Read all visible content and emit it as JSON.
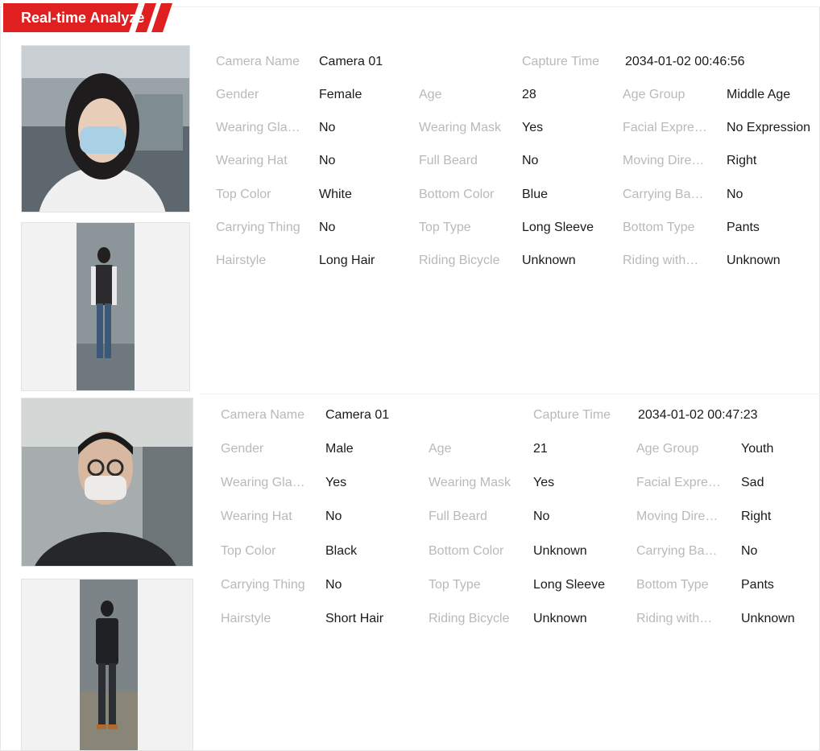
{
  "header": {
    "title": "Real-time Analyze",
    "accent": "#e02020"
  },
  "records": [
    {
      "face_image": "female-face-with-mask",
      "body_image": "female-full-body",
      "camera_name_label": "Camera Name",
      "camera_name": "Camera 01",
      "capture_time_label": "Capture Time",
      "capture_time": "2034-01-02 00:46:56",
      "attributes": [
        [
          "Gender",
          "Female",
          "Age",
          "28",
          "Age Group",
          "Middle Age"
        ],
        [
          "Wearing Gla…",
          "No",
          "Wearing Mask",
          "Yes",
          "Facial Expre…",
          "No Expression"
        ],
        [
          "Wearing Hat",
          "No",
          "Full Beard",
          "No",
          "Moving Dire…",
          "Right"
        ],
        [
          "Top Color",
          "White",
          "Bottom Color",
          "Blue",
          "Carrying Ba…",
          "No"
        ],
        [
          "Carrying Thing",
          "No",
          "Top Type",
          "Long Sleeve",
          "Bottom Type",
          "Pants"
        ],
        [
          "Hairstyle",
          "Long Hair",
          "Riding Bicycle",
          "Unknown",
          "Riding with…",
          "Unknown"
        ]
      ]
    },
    {
      "face_image": "male-face-with-mask-and-glasses",
      "body_image": "male-full-body",
      "camera_name_label": "Camera Name",
      "camera_name": "Camera 01",
      "capture_time_label": "Capture Time",
      "capture_time": "2034-01-02 00:47:23",
      "attributes": [
        [
          "Gender",
          "Male",
          "Age",
          "21",
          "Age Group",
          "Youth"
        ],
        [
          "Wearing Gla…",
          "Yes",
          "Wearing Mask",
          "Yes",
          "Facial Expre…",
          "Sad"
        ],
        [
          "Wearing Hat",
          "No",
          "Full Beard",
          "No",
          "Moving Dire…",
          "Right"
        ],
        [
          "Top Color",
          "Black",
          "Bottom Color",
          "Unknown",
          "Carrying Ba…",
          "No"
        ],
        [
          "Carrying Thing",
          "No",
          "Top Type",
          "Long Sleeve",
          "Bottom Type",
          "Pants"
        ],
        [
          "Hairstyle",
          "Short Hair",
          "Riding Bicycle",
          "Unknown",
          "Riding with…",
          "Unknown"
        ]
      ]
    }
  ]
}
